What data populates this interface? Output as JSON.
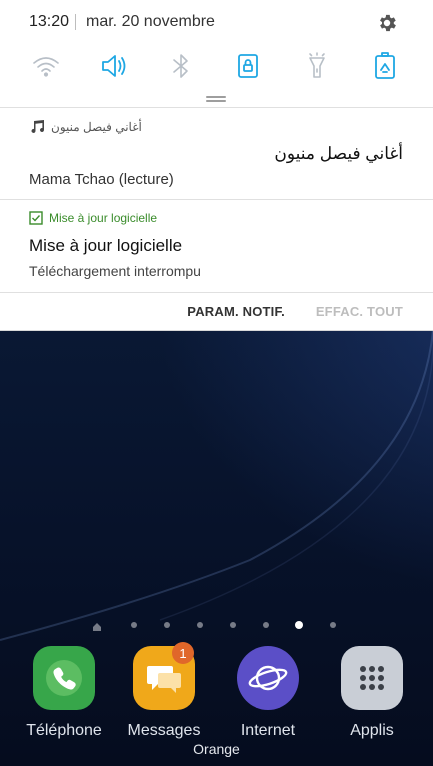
{
  "status": {
    "time": "13:20",
    "date": "mar. 20 novembre"
  },
  "quick_settings": [
    {
      "id": "wifi",
      "icon": "wifi-icon",
      "active": false
    },
    {
      "id": "sound",
      "icon": "speaker-icon",
      "active": true
    },
    {
      "id": "bluetooth",
      "icon": "bluetooth-icon",
      "active": false
    },
    {
      "id": "rotation-lock",
      "icon": "rotation-lock-icon",
      "active": true
    },
    {
      "id": "flashlight",
      "icon": "flashlight-icon",
      "active": false
    },
    {
      "id": "power-saving",
      "icon": "battery-saving-icon",
      "active": true
    }
  ],
  "notifications": {
    "music": {
      "app_name": "أغاني فيصل منيون",
      "title": "أغاني فيصل منيون",
      "subtitle": "Mama Tchao (lecture)"
    },
    "update": {
      "app_name": "Mise à jour logicielle",
      "title": "Mise à jour logicielle",
      "subtitle": "Téléchargement interrompu"
    }
  },
  "actions": {
    "notif_settings": "PARAM. NOTIF.",
    "clear_all": "EFFAC. TOUT"
  },
  "pager": {
    "pages": 7,
    "active_index": 5
  },
  "dock": [
    {
      "label": "Téléphone",
      "icon": "phone-icon"
    },
    {
      "label": "Messages",
      "icon": "messages-icon",
      "badge": "1"
    },
    {
      "label": "Internet",
      "icon": "internet-icon"
    },
    {
      "label": "Applis",
      "icon": "apps-grid-icon"
    }
  ],
  "carrier": "Orange",
  "colors": {
    "accent": "#1ea7e4",
    "update_green": "#3a8c2b",
    "badge": "#e0672a"
  }
}
